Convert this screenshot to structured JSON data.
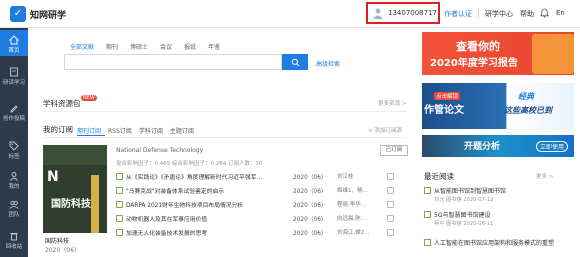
{
  "header": {
    "app_name": "知网研学",
    "user_phone": "13407008717",
    "nav_auth": "作者认证",
    "nav_center": "研学中心",
    "nav_messages": "帮助",
    "lang": "En"
  },
  "sidebar": {
    "items": [
      {
        "label": "首页",
        "icon": "home-icon"
      },
      {
        "label": "研读学习",
        "icon": "book-icon"
      },
      {
        "label": "创作投稿",
        "icon": "pen-icon"
      },
      {
        "label": "标签",
        "icon": "tag-icon"
      },
      {
        "label": "我的",
        "icon": "user-icon"
      },
      {
        "label": "团队",
        "icon": "team-icon"
      },
      {
        "label": "回收站",
        "icon": "trash-icon"
      }
    ]
  },
  "search": {
    "tabs": [
      "全部文献",
      "期刊",
      "博硕士",
      "会议",
      "报纸",
      "年鉴"
    ],
    "placeholder": "",
    "advanced_label": "高级检索"
  },
  "resource_pack": {
    "title": "学科资源包",
    "badge": "NEW",
    "more": "更多资源 >"
  },
  "subscriptions": {
    "title": "我的订阅",
    "tabs": [
      "期刊订阅",
      "RSS订阅",
      "学科订阅",
      "主题订阅"
    ],
    "add_label": "+ 添加订阅源",
    "journal": {
      "cover_title": "国防科技",
      "name": "国防科技",
      "year": "2020（06）",
      "english_name": "National Defense Technology",
      "metrics": "复合影响因子：0.465    综合影响因子：0.284    订阅人数：30",
      "subscribed_label": "已订阅"
    },
    "articles": [
      {
        "title": "从《实践论》《矛盾论》角度理解新时代习近平强军…",
        "year": "2020（06）",
        "author": "刘江桂"
      },
      {
        "title": "\"马赛克战\"对装备体系试验鉴定的启示",
        "year": "2020（06）",
        "author": "姬维1，杨..."
      },
      {
        "title": "DARPA 2021财年生物科技项目布局情况分析",
        "year": "2020（06）",
        "author": "程晓,李华..."
      },
      {
        "title": "动物机器人及其在军事应用价值",
        "year": "2020（06）",
        "author": "向远晨,陈..."
      },
      {
        "title": "加速无人化装备技术发展的思考",
        "year": "2020（06）",
        "author": "刘海江,禅2..."
      }
    ]
  },
  "banners": {
    "annual_report_line1": "查看你的",
    "annual_report_line2": "2020年度学习报告",
    "ad_tag": "点击解锁",
    "ad_left": "作管论文",
    "ad_right1": "经典",
    "ad_right2": "这些高校已到",
    "analysis_title": "开题分析",
    "analysis_button": "立即使用"
  },
  "recent": {
    "title": "最近阅读",
    "more": "更多 >",
    "items": [
      {
        "title": "从智能图书馆到智慧图书馆",
        "meta": "刘元  图书馆  2020-07-12"
      },
      {
        "title": "5G与智慧图书馆建设",
        "meta": "柯平  图书馆  2020-06-11"
      },
      {
        "title": "人工智能在图书馆应用架构和服务模式的重塑",
        "meta": ""
      }
    ]
  },
  "colors": {
    "brand": "#1f7ce0",
    "sidebar_bg": "#2d3a4b",
    "highlight_border": "#e02020"
  }
}
